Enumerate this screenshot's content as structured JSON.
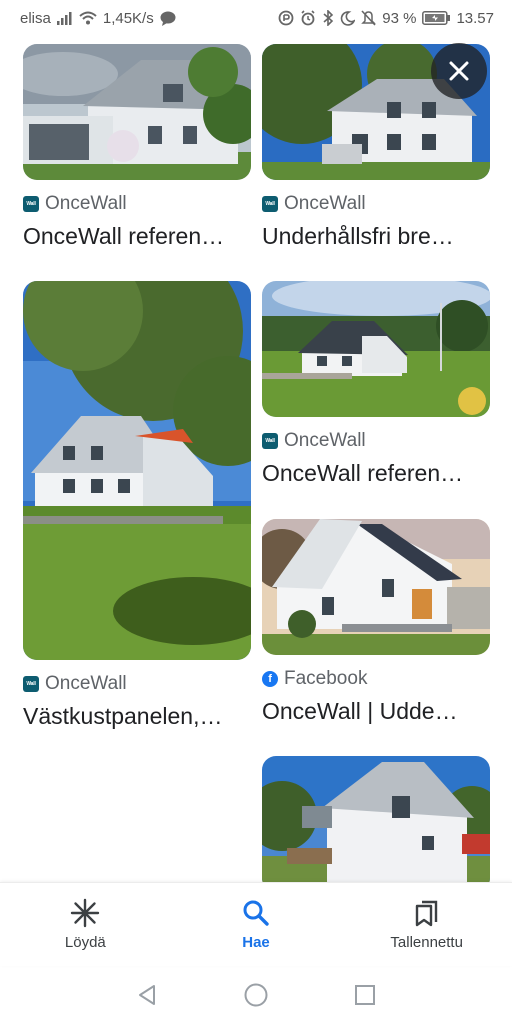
{
  "status_bar": {
    "carrier": "elisa",
    "network_speed": "1,45K/s",
    "battery": "93 %",
    "time": "13.57",
    "icons": [
      "signal-icon",
      "wifi-icon",
      "message-icon",
      "data-saver-icon",
      "alarm-icon",
      "bluetooth-icon",
      "moon-icon",
      "mute-icon",
      "battery-icon"
    ]
  },
  "results": [
    {
      "id": "r1",
      "source": "OnceWall",
      "source_icon": "oncewall-logo-icon",
      "title": "OnceWall referen…"
    },
    {
      "id": "r2",
      "source": "OnceWall",
      "source_icon": "oncewall-logo-icon",
      "title": "Underhållsfri bre…"
    },
    {
      "id": "r3",
      "source": "OnceWall",
      "source_icon": "oncewall-logo-icon",
      "title": "Västkustpanelen,…"
    },
    {
      "id": "r4",
      "source": "OnceWall",
      "source_icon": "oncewall-logo-icon",
      "title": "OnceWall referen…"
    },
    {
      "id": "r5",
      "source": "Facebook",
      "source_icon": "facebook-logo-icon",
      "title": "OnceWall | Udde…"
    },
    {
      "id": "r6",
      "source": "",
      "source_icon": "",
      "title": ""
    }
  ],
  "source_logo_text": {
    "oncewall": "Wall",
    "facebook": "f"
  },
  "close_icon": "close-icon",
  "bottom_nav": [
    {
      "label": "Löydä",
      "icon": "discover-asterisk-icon",
      "active": false
    },
    {
      "label": "Hae",
      "icon": "search-icon",
      "active": true
    },
    {
      "label": "Tallennettu",
      "icon": "saved-bookmarks-icon",
      "active": false
    }
  ],
  "system_nav": [
    "back-icon",
    "home-icon",
    "recents-icon"
  ],
  "colors": {
    "accent": "#1a73e8",
    "text": "#202124",
    "secondary_text": "#5f6368",
    "oncewall_brand": "#0d5c70",
    "facebook_brand": "#1877f2"
  }
}
